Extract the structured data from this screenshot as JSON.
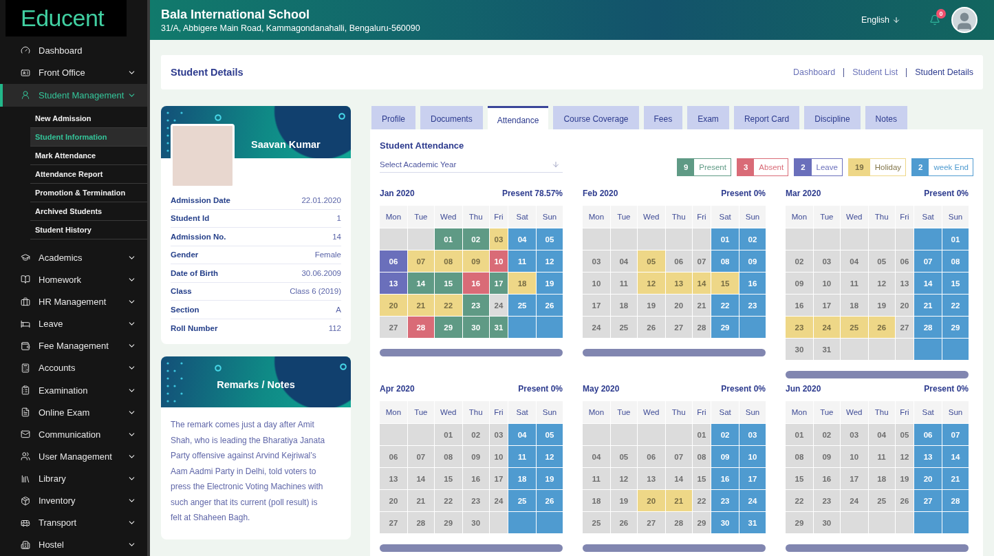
{
  "sidebar": {
    "logo": "Educent",
    "items": [
      {
        "label": "Dashboard",
        "expandable": false,
        "expanded": false
      },
      {
        "label": "Front Office",
        "expandable": true,
        "expanded": false
      },
      {
        "label": "Student Management",
        "expandable": true,
        "expanded": true,
        "children": [
          {
            "label": "New Admission",
            "selected": false
          },
          {
            "label": "Student Information",
            "selected": true
          },
          {
            "label": "Mark Attendance",
            "selected": false
          },
          {
            "label": "Attendance Report",
            "selected": false
          },
          {
            "label": "Promotion & Termination",
            "selected": false
          },
          {
            "label": "Archived Students",
            "selected": false
          },
          {
            "label": "Student History",
            "selected": false
          }
        ]
      },
      {
        "label": "Academics",
        "expandable": true,
        "expanded": false
      },
      {
        "label": "Homework",
        "expandable": true,
        "expanded": false
      },
      {
        "label": "HR Management",
        "expandable": true,
        "expanded": false
      },
      {
        "label": "Leave",
        "expandable": true,
        "expanded": false
      },
      {
        "label": "Fee Management",
        "expandable": true,
        "expanded": false
      },
      {
        "label": "Accounts",
        "expandable": true,
        "expanded": false
      },
      {
        "label": "Examination",
        "expandable": true,
        "expanded": false
      },
      {
        "label": "Online Exam",
        "expandable": true,
        "expanded": false
      },
      {
        "label": "Communication",
        "expandable": true,
        "expanded": false
      },
      {
        "label": "User Management",
        "expandable": true,
        "expanded": false
      },
      {
        "label": "Library",
        "expandable": true,
        "expanded": false
      },
      {
        "label": "Inventory",
        "expandable": true,
        "expanded": false
      },
      {
        "label": "Transport",
        "expandable": true,
        "expanded": false
      },
      {
        "label": "Hostel",
        "expandable": true,
        "expanded": false
      }
    ]
  },
  "header": {
    "school": "Bala International School",
    "address": "31/A, Abbigere Main Road, Kammagondanahalli, Bengaluru-560090",
    "language": "English",
    "notifications": "0"
  },
  "page": {
    "title": "Student Details",
    "breadcrumbs": [
      "Dashboard",
      "Student List",
      "Student Details"
    ]
  },
  "student": {
    "name": "Saavan Kumar",
    "details": [
      {
        "label": "Admission Date",
        "value": "22.01.2020"
      },
      {
        "label": "Student Id",
        "value": "1"
      },
      {
        "label": "Admission No.",
        "value": "14"
      },
      {
        "label": "Gender",
        "value": "Female"
      },
      {
        "label": "Date of Birth",
        "value": "30.06.2009"
      },
      {
        "label": "Class",
        "value": "Class 6 (2019)"
      },
      {
        "label": "Section",
        "value": "A"
      },
      {
        "label": "Roll Number",
        "value": "112"
      }
    ]
  },
  "remarks": {
    "title": "Remarks / Notes",
    "text": "The remark comes just a day after Amit Shah, who is leading the Bharatiya Janata Party offensive against Arvind Kejriwal’s Aam Aadmi Party in Delhi, told voters to press the Electronic Voting Machines with such anger that its current (poll result) is felt at Shaheen Bagh."
  },
  "tabs": [
    {
      "label": "Profile",
      "selected": false
    },
    {
      "label": "Documents",
      "selected": false
    },
    {
      "label": "Attendance",
      "selected": true
    },
    {
      "label": "Course Coverage",
      "selected": false
    },
    {
      "label": "Fees",
      "selected": false
    },
    {
      "label": "Exam",
      "selected": false
    },
    {
      "label": "Report Card",
      "selected": false
    },
    {
      "label": "Discipline",
      "selected": false
    },
    {
      "label": "Notes",
      "selected": false
    }
  ],
  "attendance": {
    "title": "Student Attendance",
    "year_select": {
      "placeholder": "Select Academic Year"
    },
    "legend": [
      {
        "count": "9",
        "label": "Present",
        "color": "#5f9a85"
      },
      {
        "count": "3",
        "label": "Absent",
        "color": "#d96b77"
      },
      {
        "count": "2",
        "label": "Leave",
        "color": "#6a6fbb"
      },
      {
        "count": "19",
        "label": "Holiday",
        "color": "#eed787"
      },
      {
        "count": "2",
        "label": "week End",
        "color": "#4f9bd0"
      }
    ],
    "months": [
      {
        "title": "Jan 2020",
        "present": "Present 78.57%",
        "weekdays": [
          "Mon",
          "Tue",
          "Wed",
          "Thu",
          "Fri",
          "Sat",
          "Sun"
        ],
        "weeks": [
          [
            {
              "color": "#dcdcdc"
            },
            {
              "color": "#dcdcdc"
            },
            {
              "day": "01",
              "color": "#5f9a85"
            },
            {
              "day": "02",
              "color": "#5f9a85"
            },
            {
              "day": "03",
              "color": "#eed787"
            },
            {
              "day": "04",
              "color": "#4f9bd0"
            },
            {
              "day": "05",
              "color": "#4f9bd0"
            }
          ],
          [
            {
              "day": "06",
              "color": "#6a6fbb"
            },
            {
              "day": "07",
              "color": "#eed787"
            },
            {
              "day": "08",
              "color": "#eed787"
            },
            {
              "day": "09",
              "color": "#eed787"
            },
            {
              "day": "10",
              "color": "#d96b77"
            },
            {
              "day": "11",
              "color": "#4f9bd0"
            },
            {
              "day": "12",
              "color": "#4f9bd0"
            }
          ],
          [
            {
              "day": "13",
              "color": "#6a6fbb"
            },
            {
              "day": "14",
              "color": "#5f9a85"
            },
            {
              "day": "15",
              "color": "#5f9a85"
            },
            {
              "day": "16",
              "color": "#d96b77"
            },
            {
              "day": "17",
              "color": "#5f9a85"
            },
            {
              "day": "18",
              "color": "#eed787"
            },
            {
              "day": "19",
              "color": "#4f9bd0"
            }
          ],
          [
            {
              "day": "20",
              "color": "#eed787"
            },
            {
              "day": "21",
              "color": "#eed787"
            },
            {
              "day": "22",
              "color": "#eed787"
            },
            {
              "day": "23",
              "color": "#5f9a85"
            },
            {
              "day": "24",
              "color": "#dcdcdc"
            },
            {
              "day": "25",
              "color": "#4f9bd0"
            },
            {
              "day": "26",
              "color": "#4f9bd0"
            }
          ],
          [
            {
              "day": "27",
              "color": "#dcdcdc"
            },
            {
              "day": "28",
              "color": "#d96b77"
            },
            {
              "day": "29",
              "color": "#5f9a85"
            },
            {
              "day": "30",
              "color": "#5f9a85"
            },
            {
              "day": "31",
              "color": "#5f9a85"
            },
            {
              "color": "#4f9bd0"
            },
            {
              "color": "#4f9bd0"
            }
          ]
        ]
      },
      {
        "title": "Feb 2020",
        "present": "Present 0%",
        "weekdays": [
          "Mon",
          "Tue",
          "Wed",
          "Thu",
          "Fri",
          "Sat",
          "Sun"
        ],
        "weeks": [
          [
            {
              "color": "#dcdcdc"
            },
            {
              "color": "#dcdcdc"
            },
            {
              "color": "#dcdcdc"
            },
            {
              "color": "#dcdcdc"
            },
            {
              "color": "#dcdcdc"
            },
            {
              "day": "01",
              "color": "#4f9bd0"
            },
            {
              "day": "02",
              "color": "#4f9bd0"
            }
          ],
          [
            {
              "day": "03",
              "color": "#dcdcdc"
            },
            {
              "day": "04",
              "color": "#dcdcdc"
            },
            {
              "day": "05",
              "color": "#eed787"
            },
            {
              "day": "06",
              "color": "#dcdcdc"
            },
            {
              "day": "07",
              "color": "#dcdcdc"
            },
            {
              "day": "08",
              "color": "#4f9bd0"
            },
            {
              "day": "09",
              "color": "#4f9bd0"
            }
          ],
          [
            {
              "day": "10",
              "color": "#dcdcdc"
            },
            {
              "day": "11",
              "color": "#dcdcdc"
            },
            {
              "day": "12",
              "color": "#eed787"
            },
            {
              "day": "13",
              "color": "#eed787"
            },
            {
              "day": "14",
              "color": "#eed787"
            },
            {
              "day": "15",
              "color": "#eed787"
            },
            {
              "day": "16",
              "color": "#4f9bd0"
            }
          ],
          [
            {
              "day": "17",
              "color": "#dcdcdc"
            },
            {
              "day": "18",
              "color": "#dcdcdc"
            },
            {
              "day": "19",
              "color": "#dcdcdc"
            },
            {
              "day": "20",
              "color": "#dcdcdc"
            },
            {
              "day": "21",
              "color": "#dcdcdc"
            },
            {
              "day": "22",
              "color": "#4f9bd0"
            },
            {
              "day": "23",
              "color": "#4f9bd0"
            }
          ],
          [
            {
              "day": "24",
              "color": "#dcdcdc"
            },
            {
              "day": "25",
              "color": "#dcdcdc"
            },
            {
              "day": "26",
              "color": "#dcdcdc"
            },
            {
              "day": "27",
              "color": "#dcdcdc"
            },
            {
              "day": "28",
              "color": "#dcdcdc"
            },
            {
              "day": "29",
              "color": "#4f9bd0"
            },
            {
              "color": "#4f9bd0"
            }
          ]
        ]
      },
      {
        "title": "Mar 2020",
        "present": "Present 0%",
        "weekdays": [
          "Mon",
          "Tue",
          "Wed",
          "Thu",
          "Fri",
          "Sat",
          "Sun"
        ],
        "weeks": [
          [
            {
              "color": "#dcdcdc"
            },
            {
              "color": "#dcdcdc"
            },
            {
              "color": "#dcdcdc"
            },
            {
              "color": "#dcdcdc"
            },
            {
              "color": "#dcdcdc"
            },
            {
              "color": "#4f9bd0"
            },
            {
              "day": "01",
              "color": "#4f9bd0"
            }
          ],
          [
            {
              "day": "02",
              "color": "#dcdcdc"
            },
            {
              "day": "03",
              "color": "#dcdcdc"
            },
            {
              "day": "04",
              "color": "#dcdcdc"
            },
            {
              "day": "05",
              "color": "#dcdcdc"
            },
            {
              "day": "06",
              "color": "#dcdcdc"
            },
            {
              "day": "07",
              "color": "#4f9bd0"
            },
            {
              "day": "08",
              "color": "#4f9bd0"
            }
          ],
          [
            {
              "day": "09",
              "color": "#dcdcdc"
            },
            {
              "day": "10",
              "color": "#dcdcdc"
            },
            {
              "day": "11",
              "color": "#dcdcdc"
            },
            {
              "day": "12",
              "color": "#dcdcdc"
            },
            {
              "day": "13",
              "color": "#dcdcdc"
            },
            {
              "day": "14",
              "color": "#4f9bd0"
            },
            {
              "day": "15",
              "color": "#4f9bd0"
            }
          ],
          [
            {
              "day": "16",
              "color": "#dcdcdc"
            },
            {
              "day": "17",
              "color": "#dcdcdc"
            },
            {
              "day": "18",
              "color": "#dcdcdc"
            },
            {
              "day": "19",
              "color": "#dcdcdc"
            },
            {
              "day": "20",
              "color": "#dcdcdc"
            },
            {
              "day": "21",
              "color": "#4f9bd0"
            },
            {
              "day": "22",
              "color": "#4f9bd0"
            }
          ],
          [
            {
              "day": "23",
              "color": "#eed787"
            },
            {
              "day": "24",
              "color": "#eed787"
            },
            {
              "day": "25",
              "color": "#eed787"
            },
            {
              "day": "26",
              "color": "#eed787"
            },
            {
              "day": "27",
              "color": "#dcdcdc"
            },
            {
              "day": "28",
              "color": "#4f9bd0"
            },
            {
              "day": "29",
              "color": "#4f9bd0"
            }
          ],
          [
            {
              "day": "30",
              "color": "#dcdcdc"
            },
            {
              "day": "31",
              "color": "#dcdcdc"
            },
            {
              "color": "#dcdcdc"
            },
            {
              "color": "#dcdcdc"
            },
            {
              "color": "#dcdcdc"
            },
            {
              "color": "#4f9bd0"
            },
            {
              "color": "#4f9bd0"
            }
          ]
        ]
      },
      {
        "title": "Apr 2020",
        "present": "Present 0%",
        "weekdays": [
          "Mon",
          "Tue",
          "Wed",
          "Thu",
          "Fri",
          "Sat",
          "Sun"
        ],
        "weeks": [
          [
            {
              "color": "#dcdcdc"
            },
            {
              "color": "#dcdcdc"
            },
            {
              "day": "01",
              "color": "#dcdcdc"
            },
            {
              "day": "02",
              "color": "#dcdcdc"
            },
            {
              "day": "03",
              "color": "#dcdcdc"
            },
            {
              "day": "04",
              "color": "#4f9bd0"
            },
            {
              "day": "05",
              "color": "#4f9bd0"
            }
          ],
          [
            {
              "day": "06",
              "color": "#dcdcdc"
            },
            {
              "day": "07",
              "color": "#dcdcdc"
            },
            {
              "day": "08",
              "color": "#dcdcdc"
            },
            {
              "day": "09",
              "color": "#dcdcdc"
            },
            {
              "day": "10",
              "color": "#dcdcdc"
            },
            {
              "day": "11",
              "color": "#4f9bd0"
            },
            {
              "day": "12",
              "color": "#4f9bd0"
            }
          ],
          [
            {
              "day": "13",
              "color": "#dcdcdc"
            },
            {
              "day": "14",
              "color": "#dcdcdc"
            },
            {
              "day": "15",
              "color": "#dcdcdc"
            },
            {
              "day": "16",
              "color": "#dcdcdc"
            },
            {
              "day": "17",
              "color": "#dcdcdc"
            },
            {
              "day": "18",
              "color": "#4f9bd0"
            },
            {
              "day": "19",
              "color": "#4f9bd0"
            }
          ],
          [
            {
              "day": "20",
              "color": "#dcdcdc"
            },
            {
              "day": "21",
              "color": "#dcdcdc"
            },
            {
              "day": "22",
              "color": "#dcdcdc"
            },
            {
              "day": "23",
              "color": "#dcdcdc"
            },
            {
              "day": "24",
              "color": "#dcdcdc"
            },
            {
              "day": "25",
              "color": "#4f9bd0"
            },
            {
              "day": "26",
              "color": "#4f9bd0"
            }
          ],
          [
            {
              "day": "27",
              "color": "#dcdcdc"
            },
            {
              "day": "28",
              "color": "#dcdcdc"
            },
            {
              "day": "29",
              "color": "#dcdcdc"
            },
            {
              "day": "30",
              "color": "#dcdcdc"
            },
            {
              "color": "#dcdcdc"
            },
            {
              "color": "#4f9bd0"
            },
            {
              "color": "#4f9bd0"
            }
          ]
        ]
      },
      {
        "title": "May 2020",
        "present": "Present 0%",
        "weekdays": [
          "Mon",
          "Tue",
          "Wed",
          "Thu",
          "Fri",
          "Sat",
          "Sun"
        ],
        "weeks": [
          [
            {
              "color": "#dcdcdc"
            },
            {
              "color": "#dcdcdc"
            },
            {
              "color": "#dcdcdc"
            },
            {
              "color": "#dcdcdc"
            },
            {
              "day": "01",
              "color": "#dcdcdc"
            },
            {
              "day": "02",
              "color": "#4f9bd0"
            },
            {
              "day": "03",
              "color": "#4f9bd0"
            }
          ],
          [
            {
              "day": "04",
              "color": "#dcdcdc"
            },
            {
              "day": "05",
              "color": "#dcdcdc"
            },
            {
              "day": "06",
              "color": "#dcdcdc"
            },
            {
              "day": "07",
              "color": "#dcdcdc"
            },
            {
              "day": "08",
              "color": "#dcdcdc"
            },
            {
              "day": "09",
              "color": "#4f9bd0"
            },
            {
              "day": "10",
              "color": "#4f9bd0"
            }
          ],
          [
            {
              "day": "11",
              "color": "#dcdcdc"
            },
            {
              "day": "12",
              "color": "#dcdcdc"
            },
            {
              "day": "13",
              "color": "#dcdcdc"
            },
            {
              "day": "14",
              "color": "#dcdcdc"
            },
            {
              "day": "15",
              "color": "#dcdcdc"
            },
            {
              "day": "16",
              "color": "#4f9bd0"
            },
            {
              "day": "17",
              "color": "#4f9bd0"
            }
          ],
          [
            {
              "day": "18",
              "color": "#dcdcdc"
            },
            {
              "day": "19",
              "color": "#dcdcdc"
            },
            {
              "day": "20",
              "color": "#eed787"
            },
            {
              "day": "21",
              "color": "#eed787"
            },
            {
              "day": "22",
              "color": "#dcdcdc"
            },
            {
              "day": "23",
              "color": "#4f9bd0"
            },
            {
              "day": "24",
              "color": "#4f9bd0"
            }
          ],
          [
            {
              "day": "25",
              "color": "#dcdcdc"
            },
            {
              "day": "26",
              "color": "#dcdcdc"
            },
            {
              "day": "27",
              "color": "#dcdcdc"
            },
            {
              "day": "28",
              "color": "#dcdcdc"
            },
            {
              "day": "29",
              "color": "#dcdcdc"
            },
            {
              "day": "30",
              "color": "#4f9bd0"
            },
            {
              "day": "31",
              "color": "#4f9bd0"
            }
          ]
        ]
      },
      {
        "title": "Jun 2020",
        "present": "Present 0%",
        "weekdays": [
          "Mon",
          "Tue",
          "Wed",
          "Thu",
          "Fri",
          "Sat",
          "Sun"
        ],
        "weeks": [
          [
            {
              "day": "01",
              "color": "#dcdcdc"
            },
            {
              "day": "02",
              "color": "#dcdcdc"
            },
            {
              "day": "03",
              "color": "#dcdcdc"
            },
            {
              "day": "04",
              "color": "#dcdcdc"
            },
            {
              "day": "05",
              "color": "#dcdcdc"
            },
            {
              "day": "06",
              "color": "#4f9bd0"
            },
            {
              "day": "07",
              "color": "#4f9bd0"
            }
          ],
          [
            {
              "day": "08",
              "color": "#dcdcdc"
            },
            {
              "day": "09",
              "color": "#dcdcdc"
            },
            {
              "day": "10",
              "color": "#dcdcdc"
            },
            {
              "day": "11",
              "color": "#dcdcdc"
            },
            {
              "day": "12",
              "color": "#dcdcdc"
            },
            {
              "day": "13",
              "color": "#4f9bd0"
            },
            {
              "day": "14",
              "color": "#4f9bd0"
            }
          ],
          [
            {
              "day": "15",
              "color": "#dcdcdc"
            },
            {
              "day": "16",
              "color": "#dcdcdc"
            },
            {
              "day": "17",
              "color": "#dcdcdc"
            },
            {
              "day": "18",
              "color": "#dcdcdc"
            },
            {
              "day": "19",
              "color": "#dcdcdc"
            },
            {
              "day": "20",
              "color": "#4f9bd0"
            },
            {
              "day": "21",
              "color": "#4f9bd0"
            }
          ],
          [
            {
              "day": "22",
              "color": "#dcdcdc"
            },
            {
              "day": "23",
              "color": "#dcdcdc"
            },
            {
              "day": "24",
              "color": "#dcdcdc"
            },
            {
              "day": "25",
              "color": "#dcdcdc"
            },
            {
              "day": "26",
              "color": "#dcdcdc"
            },
            {
              "day": "27",
              "color": "#4f9bd0"
            },
            {
              "day": "28",
              "color": "#4f9bd0"
            }
          ],
          [
            {
              "day": "29",
              "color": "#dcdcdc"
            },
            {
              "day": "30",
              "color": "#dcdcdc"
            },
            {
              "color": "#dcdcdc"
            },
            {
              "color": "#dcdcdc"
            },
            {
              "color": "#dcdcdc"
            },
            {
              "color": "#4f9bd0"
            },
            {
              "color": "#4f9bd0"
            }
          ]
        ]
      }
    ]
  }
}
